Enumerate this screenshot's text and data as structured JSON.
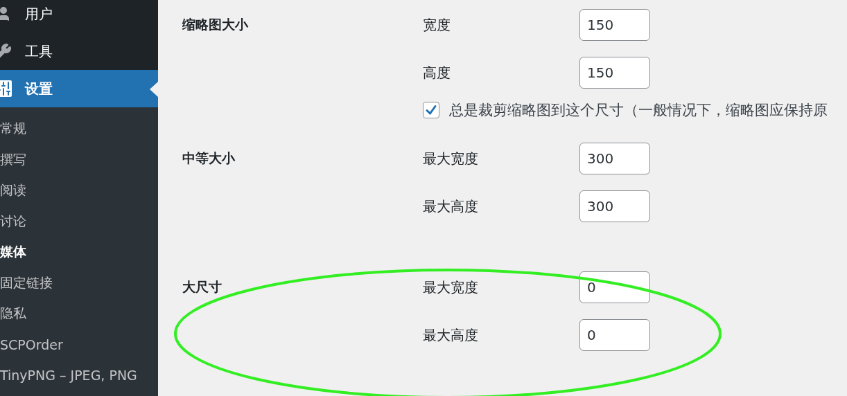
{
  "sidebar": {
    "items": [
      {
        "label": "用户",
        "kind": "user",
        "selected": false
      },
      {
        "label": "工具",
        "kind": "tools",
        "selected": false
      },
      {
        "label": "设置",
        "kind": "settings",
        "selected": true
      }
    ],
    "submenu": [
      {
        "label": "常规",
        "selected": false
      },
      {
        "label": "撰写",
        "selected": false
      },
      {
        "label": "阅读",
        "selected": false
      },
      {
        "label": "讨论",
        "selected": false
      },
      {
        "label": "媒体",
        "selected": true
      },
      {
        "label": "固定链接",
        "selected": false
      },
      {
        "label": "隐私",
        "selected": false
      },
      {
        "label": "SCPOrder",
        "selected": false
      },
      {
        "label": "TinyPNG – JPEG, PNG",
        "selected": false
      }
    ]
  },
  "sections": [
    {
      "title": "缩略图大小",
      "fields": [
        {
          "label": "宽度",
          "value": "150"
        },
        {
          "label": "高度",
          "value": "150"
        }
      ],
      "checkbox": {
        "label": "总是裁剪缩略图到这个尺寸（一般情况下，缩略图应保持原",
        "checked": true
      }
    },
    {
      "title": "中等大小",
      "fields": [
        {
          "label": "最大宽度",
          "value": "300"
        },
        {
          "label": "最大高度",
          "value": "300"
        }
      ]
    },
    {
      "title": "大尺寸",
      "fields": [
        {
          "label": "最大宽度",
          "value": "0"
        },
        {
          "label": "最大高度",
          "value": "0"
        }
      ]
    }
  ],
  "highlight": {
    "kind": "ellipse"
  }
}
